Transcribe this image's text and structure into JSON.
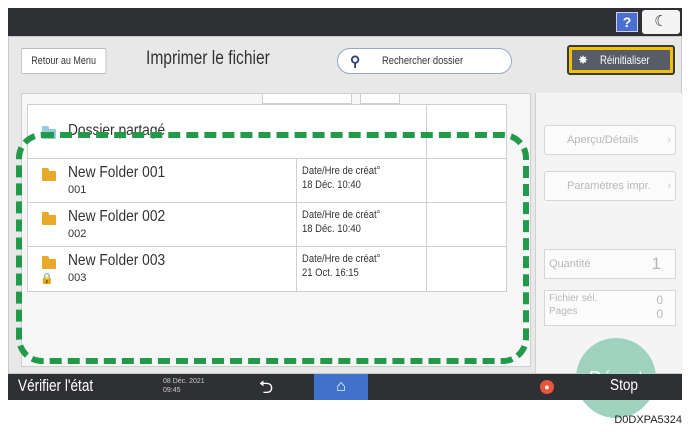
{
  "header": {
    "help_label": "?",
    "moon_icon": "moon-icon"
  },
  "toolbar": {
    "back_label": "Retour au Menu",
    "title": "Imprimer le fichier",
    "search_label": "Rechercher dossier",
    "reset_label": "Réinitialiser"
  },
  "list": {
    "shared": "Dossier partagé",
    "rows": [
      {
        "name": "New Folder 001",
        "number": "001",
        "date_label": "Date/Hre de créat°",
        "date": "18 Déc.   10:40",
        "locked": false
      },
      {
        "name": "New Folder 002",
        "number": "002",
        "date_label": "Date/Hre de créat°",
        "date": "18 Déc.   10:40",
        "locked": false
      },
      {
        "name": "New Folder 003",
        "number": "003",
        "date_label": "Date/Hre de créat°",
        "date": "21 Oct.   16:15",
        "locked": true
      }
    ]
  },
  "right": {
    "preview_label": "Aperçu/Détails",
    "print_params_label": "Paramètres impr.",
    "qty_label": "Quantité",
    "qty_value": "1",
    "file_sel_label": "Fichier sél.",
    "file_sel_value": "0",
    "pages_label": "Pages",
    "pages_value": "0",
    "depart_label": "Départ"
  },
  "footer": {
    "check_label": "Vérifier l'état",
    "date": "08 Déc. 2021",
    "time": "09:45",
    "stop_label": "Stop"
  },
  "figure_code": "D0DXPA5324",
  "colors": {
    "accent_blue": "#3f72c8",
    "dash_green": "#219a49",
    "reset_yellow": "#f2c100",
    "depart_green": "#9fd3c0"
  }
}
